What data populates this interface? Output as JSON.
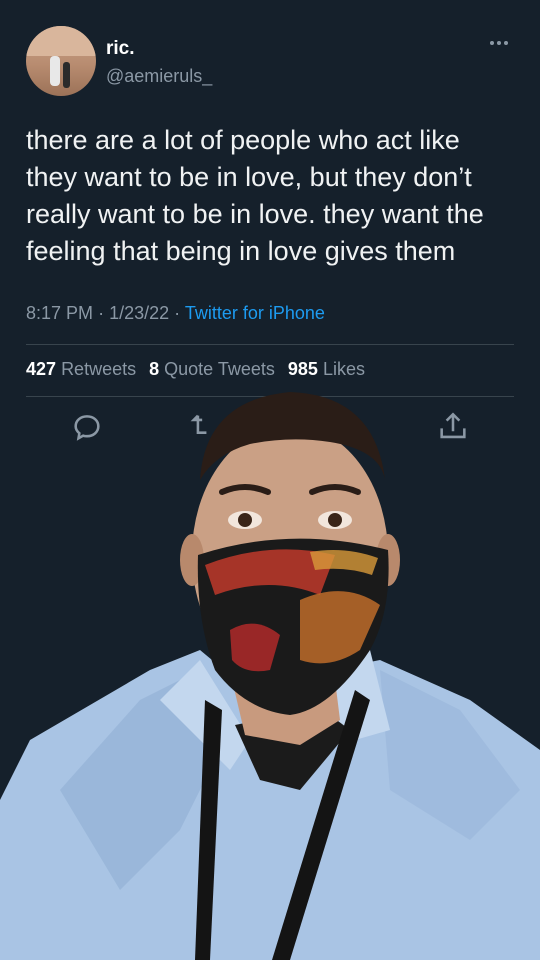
{
  "tweet": {
    "display_name": "ric.",
    "handle": "@aemieruls_",
    "text": "there are a lot of people who act like they want to be in love, but they don’t really want to be in love. they want the feeling that being in love gives them",
    "time": "8:17 PM",
    "date": "1/23/22",
    "source": "Twitter for iPhone",
    "separator": "·"
  },
  "stats": {
    "retweets_count": "427",
    "retweets_label": "Retweets",
    "quotes_count": "8",
    "quotes_label": "Quote Tweets",
    "likes_count": "985",
    "likes_label": "Likes"
  },
  "icons": {
    "reply": "reply-icon",
    "retweet": "retweet-icon",
    "like": "like-icon",
    "share": "share-icon",
    "more": "more-icon"
  },
  "colors": {
    "background": "#15202b",
    "link": "#1d9bf0",
    "muted": "#8b98a5"
  }
}
